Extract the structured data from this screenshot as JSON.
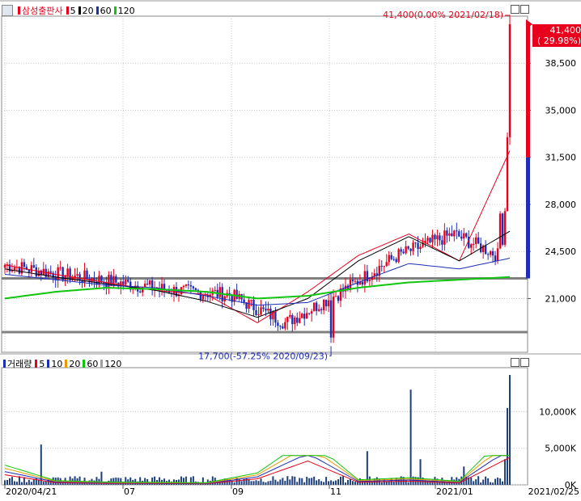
{
  "price_panel": {
    "legend": {
      "title": "삼성출판사",
      "ma": [
        {
          "label": "5",
          "color": "#e8001c"
        },
        {
          "label": "20",
          "color": "#000000"
        },
        {
          "label": "60",
          "color": "#1e2fb4"
        },
        {
          "label": "120",
          "color": "#11c511"
        }
      ]
    },
    "high_annotation": "41,400(0.00% 2021/02/18)",
    "low_annotation": "17,700(-57.25% 2020/09/23)",
    "current_price": "41,400",
    "current_change": "( 29.98%)",
    "y_ticks": [
      "38,500",
      "35,000",
      "31,500",
      "28,000",
      "24,500",
      "21,000"
    ]
  },
  "volume_panel": {
    "legend": {
      "title": "거래량",
      "ma": [
        {
          "label": "5",
          "color": "#e8001c"
        },
        {
          "label": "10",
          "color": "#1e2fb4"
        },
        {
          "label": "20",
          "color": "#e89a00"
        },
        {
          "label": "60",
          "color": "#11c511"
        },
        {
          "label": "120",
          "color": "#a0a0a0"
        }
      ]
    },
    "y_ticks": [
      "10,000K",
      "5,000K",
      "0K"
    ]
  },
  "x_axis": {
    "ticks": [
      "2020/04/21",
      "07",
      "09",
      "11",
      "2021/01"
    ],
    "end_label": "2021/02/25"
  },
  "colors": {
    "up": "#e8001c",
    "down": "#1e2fb4",
    "ma5": "#e8001c",
    "ma20": "#000000",
    "ma60": "#1e2fb4",
    "ma120": "#11c511",
    "volume": "#1e3f7a"
  },
  "chart_data": {
    "type": "line",
    "ylim": [
      17000,
      42000
    ],
    "y_ticks": [
      21000,
      24500,
      28000,
      31500,
      35000,
      38500
    ],
    "horizontal_lines": [
      22500,
      18500
    ],
    "x": [
      "2020-04",
      "2020-05",
      "2020-06",
      "2020-07",
      "2020-08",
      "2020-09",
      "2020-10",
      "2020-11",
      "2020-12",
      "2021-01",
      "2021-02"
    ],
    "series": [
      {
        "name": "5",
        "values": [
          23500,
          22800,
          22200,
          21600,
          21300,
          19200,
          21500,
          24200,
          25800,
          23800,
          32000
        ]
      },
      {
        "name": "20",
        "values": [
          23200,
          22600,
          22100,
          21600,
          20800,
          19600,
          21000,
          23800,
          25600,
          23800,
          26000
        ]
      },
      {
        "name": "60",
        "values": [
          22800,
          22400,
          22000,
          21800,
          21200,
          20500,
          20700,
          22200,
          23600,
          23200,
          24000
        ]
      },
      {
        "name": "120",
        "values": [
          21000,
          21500,
          21800,
          21700,
          21500,
          21000,
          21200,
          21800,
          22200,
          22400,
          22600
        ]
      }
    ],
    "annotations": [
      {
        "label": "41,400(0.00% 2021/02/18)",
        "x": "2021-02-18",
        "y": 41400
      },
      {
        "label": "17,700(-57.25% 2020/09/23)",
        "x": "2020-09-23",
        "y": 17700
      }
    ],
    "volume": {
      "ylim": [
        0,
        16000
      ],
      "y_ticks": [
        0,
        5000,
        10000
      ],
      "unit": "K",
      "values": [
        5500,
        1200,
        800,
        700,
        600,
        3300,
        13000,
        1400,
        2000,
        1000,
        15000
      ]
    }
  }
}
